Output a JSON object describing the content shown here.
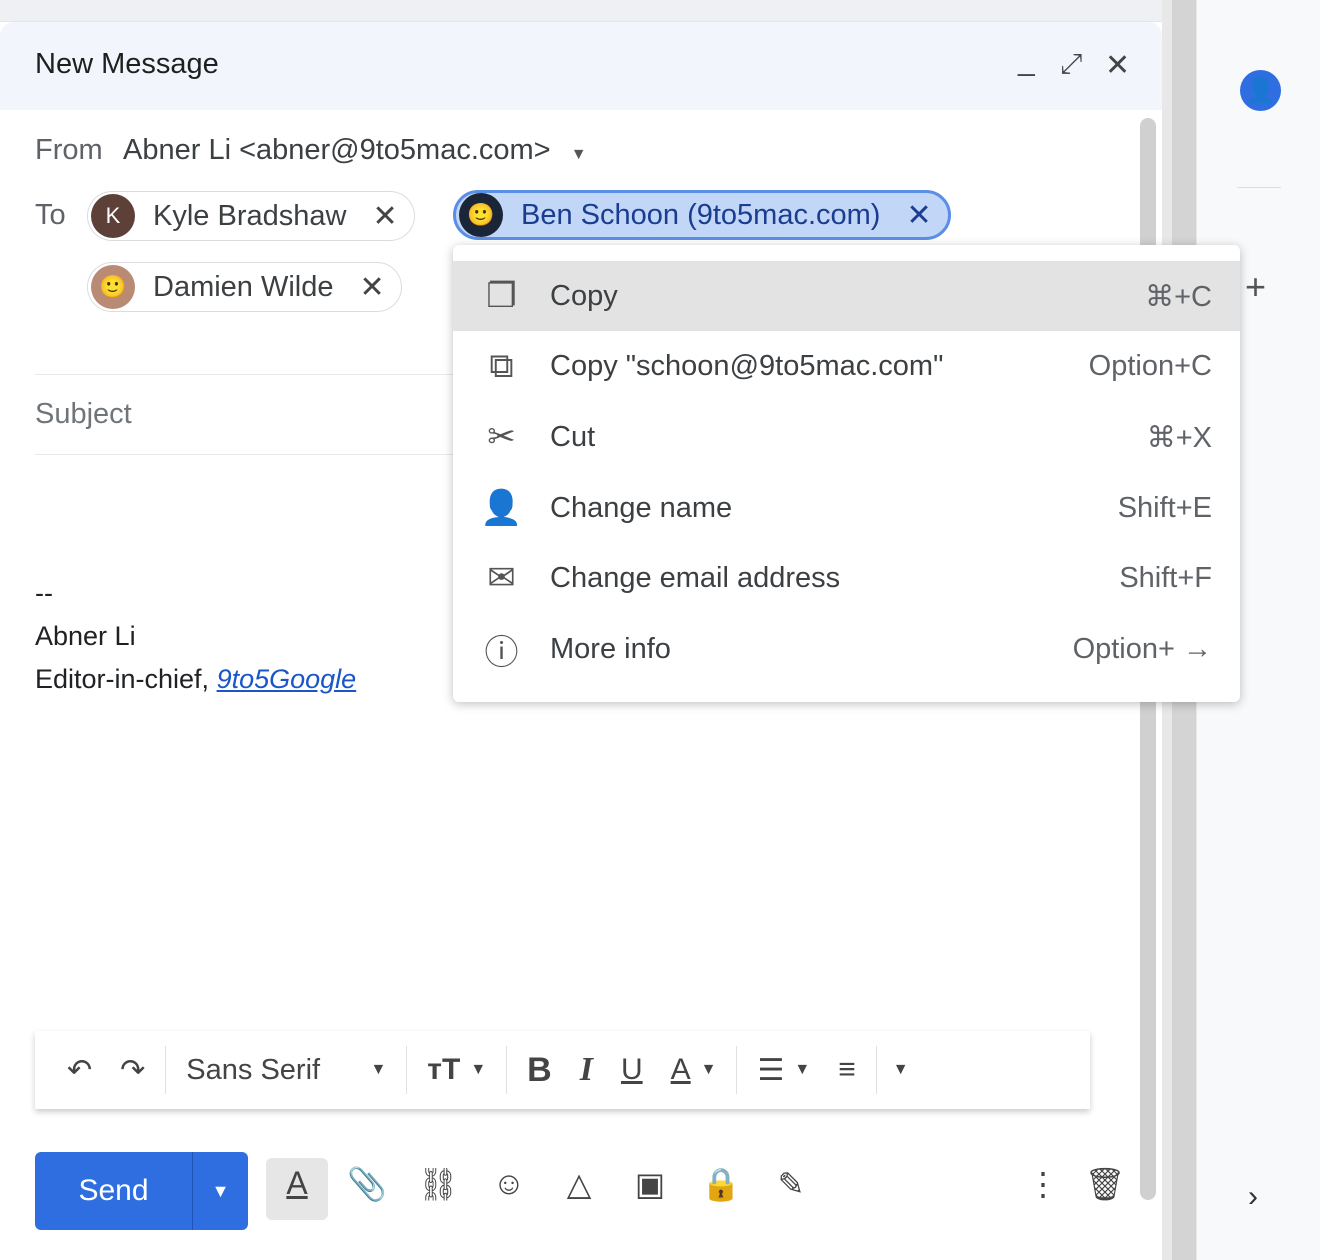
{
  "compose": {
    "title": "New Message",
    "from_label": "From",
    "from_value": "Abner Li <abner@9to5mac.com>",
    "to_label": "To",
    "subject_placeholder": "Subject",
    "recipients": [
      {
        "name": "Kyle Bradshaw",
        "initial": "K"
      },
      {
        "name": "Ben Schoon (9to5mac.com)"
      },
      {
        "name": "Damien Wilde"
      }
    ],
    "signature": {
      "dashes": "--",
      "name": "Abner Li",
      "title": "Editor-in-chief, ",
      "link": "9to5Google"
    }
  },
  "menu": [
    {
      "label": "Copy",
      "shortcut": "⌘+C",
      "icon": "copy-icon"
    },
    {
      "label": "Copy \"schoon@9to5mac.com\"",
      "shortcut": "Option+C",
      "icon": "copy-email-icon"
    },
    {
      "label": "Cut",
      "shortcut": "⌘+X",
      "icon": "scissors-icon"
    },
    {
      "label": "Change name",
      "shortcut": "Shift+E",
      "icon": "edit-person-icon"
    },
    {
      "label": "Change email address",
      "shortcut": "Shift+F",
      "icon": "edit-mail-icon"
    },
    {
      "label": "More info",
      "shortcut": "Option+ →",
      "icon": "info-icon"
    }
  ],
  "toolbar": {
    "font": "Sans Serif"
  },
  "send": {
    "label": "Send"
  },
  "colors": {
    "accent": "#2e6ee0",
    "chip_selected": "#c2d7f8"
  }
}
